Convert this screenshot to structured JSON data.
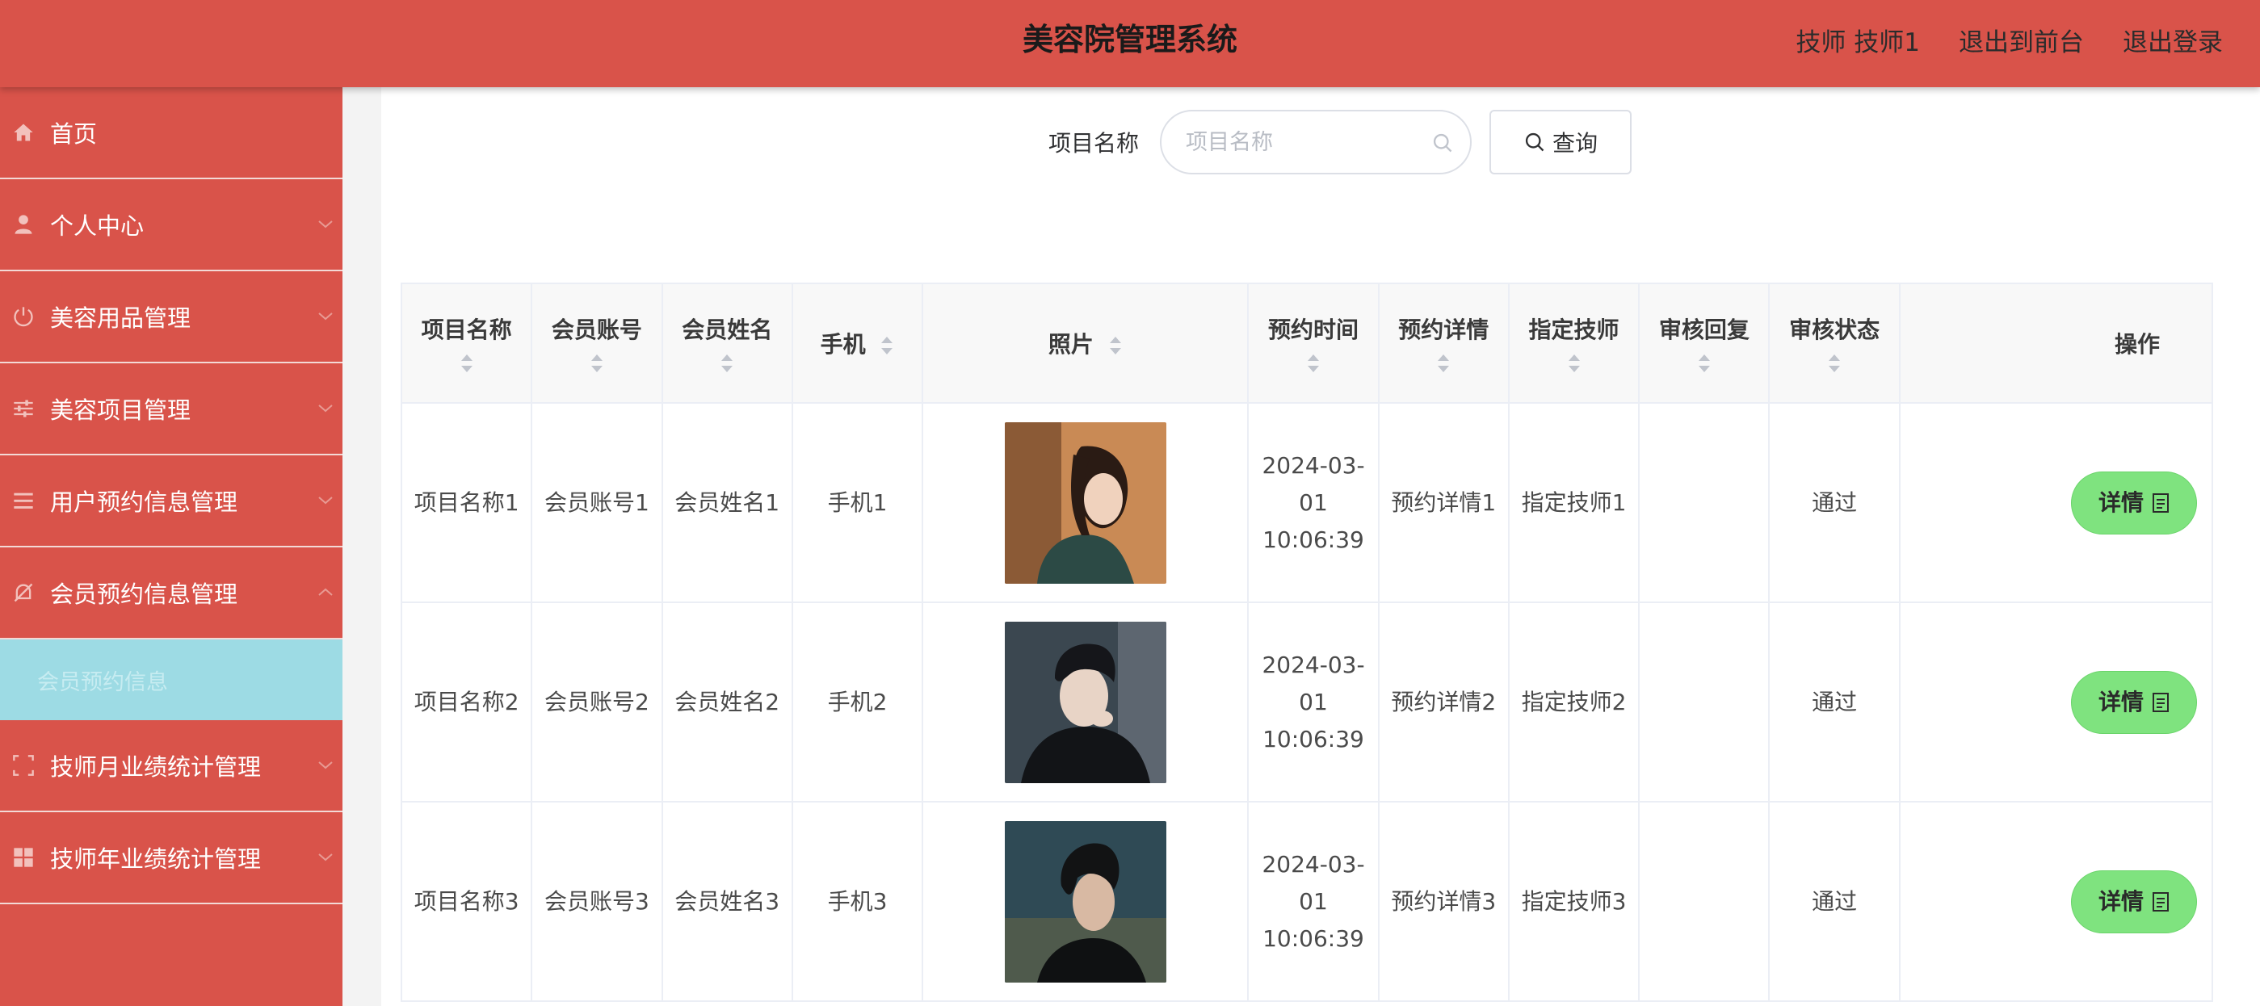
{
  "header": {
    "title": "美容院管理系统",
    "user": "技师 技师1",
    "to_front": "退出到前台",
    "logout": "退出登录"
  },
  "sidebar": {
    "items": [
      {
        "label": "首页",
        "icon": "home-icon"
      },
      {
        "label": "个人中心",
        "icon": "user-icon"
      },
      {
        "label": "美容用品管理",
        "icon": "power-icon"
      },
      {
        "label": "美容项目管理",
        "icon": "sliders-icon"
      },
      {
        "label": "用户预约信息管理",
        "icon": "list-icon"
      },
      {
        "label": "会员预约信息管理",
        "icon": "bell-off-icon"
      },
      {
        "label": "技师月业绩统计管理",
        "icon": "frame-icon"
      },
      {
        "label": "技师年业绩统计管理",
        "icon": "grid-icon"
      }
    ],
    "active_sub": "会员预约信息"
  },
  "search": {
    "label": "项目名称",
    "placeholder": "项目名称",
    "button": "查询"
  },
  "table": {
    "columns": [
      "项目名称",
      "会员账号",
      "会员姓名",
      "手机",
      "照片",
      "预约时间",
      "预约详情",
      "指定技师",
      "审核回复",
      "审核状态",
      "操作"
    ],
    "rows": [
      {
        "project": "项目名称1",
        "account": "会员账号1",
        "name": "会员姓名1",
        "phone": "手机1",
        "photo": "portrait-woman-green-coat",
        "time": "2024-03-01 10:06:39",
        "details": "预约详情1",
        "tech": "指定技师1",
        "reply": "",
        "status": "通过",
        "action": "详情"
      },
      {
        "project": "项目名称2",
        "account": "会员账号2",
        "name": "会员姓名2",
        "phone": "手机2",
        "photo": "portrait-man-black-jacket",
        "time": "2024-03-01 10:06:39",
        "details": "预约详情2",
        "tech": "指定技师2",
        "reply": "",
        "status": "通过",
        "action": "详情"
      },
      {
        "project": "项目名称3",
        "account": "会员账号3",
        "name": "会员姓名3",
        "phone": "手机3",
        "photo": "portrait-man-profile-dusk",
        "time": "2024-03-01 10:06:39",
        "details": "预约详情3",
        "tech": "指定技师3",
        "reply": "",
        "status": "通过",
        "action": "详情"
      }
    ]
  },
  "colors": {
    "primary": "#d9534a",
    "active_sub_bg": "#9ddbe4",
    "detail_button": "#7fe37f"
  }
}
